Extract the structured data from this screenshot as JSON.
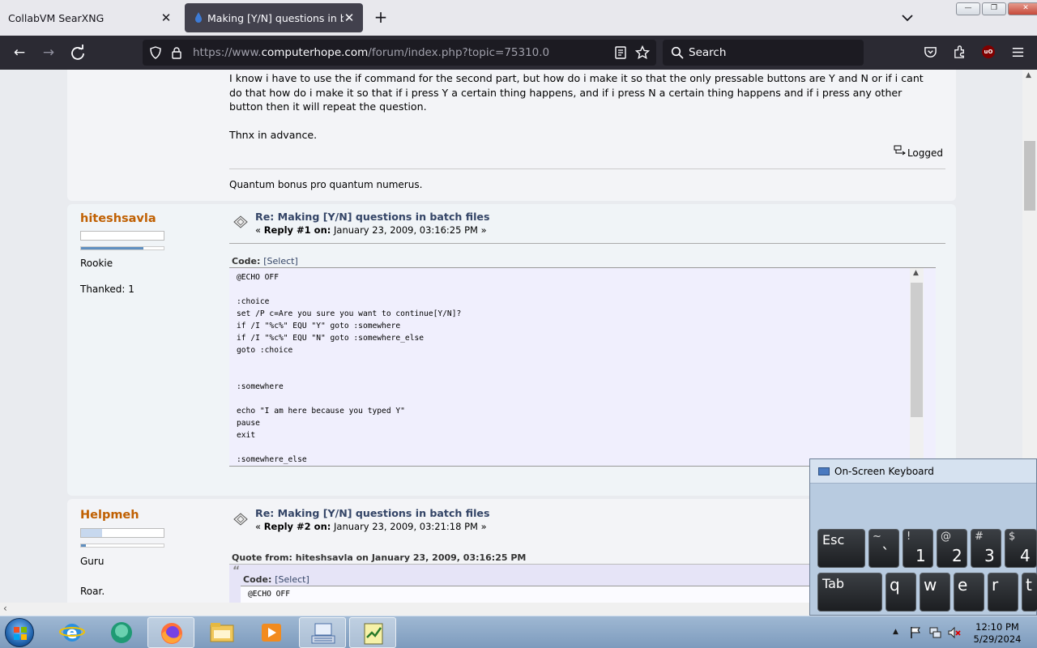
{
  "browser": {
    "tabs": [
      {
        "title": "CollabVM SearXNG",
        "active": false
      },
      {
        "title": "Making [Y/N] questions in batch files",
        "active": true
      }
    ],
    "url_prefix": "https://www.",
    "url_domain": "computerhope.com",
    "url_path": "/forum/index.php?topic=75310.0",
    "search_placeholder": "Search",
    "ubo_badge": "uO",
    "window_buttons": [
      "—",
      "❐",
      "✕"
    ]
  },
  "posts": [
    {
      "body_lines": [
        "I know i have to use the if command for the second part, but how do i make it so that the only pressable buttons are Y and N or if i cant",
        "do that how do i make it so that if i press Y a certain thing happens, and if i press N a certain thing happens and if i press any other",
        "button then it will repeat the question."
      ],
      "closing": "Thnx in advance.",
      "logged": "Logged",
      "signature": "Quantum bonus pro quantum numerus."
    },
    {
      "author": "hiteshsavla",
      "rank": "Rookie",
      "thanked": "Thanked: 1",
      "subject": "Re: Making [Y/N] questions in batch files",
      "reply_prefix": "« ",
      "reply_label": "Reply #1 on:",
      "date": " January 23, 2009, 03:16:25 PM »",
      "code_label": "Code:",
      "code_select": "[Select]",
      "code_lines": [
        "@ECHO OFF",
        "",
        ":choice",
        "set /P c=Are you sure you want to continue[Y/N]?",
        "if /I \"%c%\" EQU \"Y\" goto :somewhere",
        "if /I \"%c%\" EQU \"N\" goto :somewhere_else",
        "goto :choice",
        "",
        "",
        ":somewhere",
        "",
        "echo \"I am here because you typed Y\"",
        "pause",
        "exit",
        "",
        ":somewhere_else"
      ]
    },
    {
      "author": "Helpmeh",
      "rank": "Guru",
      "motto": "Roar.",
      "subject": "Re: Making [Y/N] questions in batch files",
      "reply_prefix": "« ",
      "reply_label": "Reply #2 on:",
      "date": " January 23, 2009, 03:21:18 PM »",
      "quote_from": "Quote from: hiteshsavla on January 23, 2009, 03:16:25 PM",
      "code_label": "Code:",
      "code_select": "[Select]",
      "code_first_line": "@ECHO OFF"
    }
  ],
  "osk": {
    "title": "On-Screen Keyboard",
    "row1": [
      {
        "word": "Esc"
      },
      {
        "shift": "~",
        "main": "`"
      },
      {
        "shift": "!",
        "main": "1"
      },
      {
        "shift": "@",
        "main": "2"
      },
      {
        "shift": "#",
        "main": "3"
      },
      {
        "shift": "$",
        "main": "4"
      }
    ],
    "row2": [
      {
        "word": "Tab"
      },
      {
        "main": "q"
      },
      {
        "main": "w"
      },
      {
        "main": "e"
      },
      {
        "main": "r"
      },
      {
        "main": "t"
      }
    ]
  },
  "taskbar": {
    "clock_time": "12:10 PM",
    "clock_date": "5/29/2024",
    "apps": [
      "internet-explorer",
      "chat-app",
      "firefox",
      "file-explorer",
      "media-player",
      "keyboard-app",
      "notepad-app"
    ]
  }
}
